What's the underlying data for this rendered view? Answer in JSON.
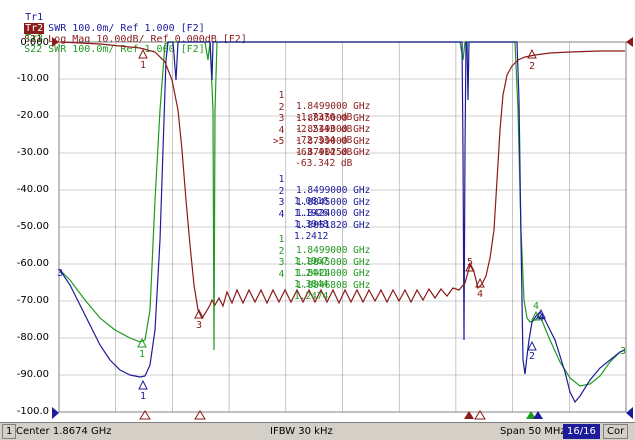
{
  "colors": {
    "s11": "#1c1c9a",
    "s21": "#8b1a1a",
    "s22": "#1f9a1f",
    "grid": "#a0a0a0",
    "plot_bg": "#ffffff",
    "status_bg": "#d4d0c8"
  },
  "traces": [
    {
      "id": "Tr1",
      "label": "S11 SWR 100.0m/ Ref 1.000 [F2]",
      "active": false
    },
    {
      "id": "Tr2",
      "label": "S21 Log Mag 10.00dB/ Ref 0.000dB [F2]",
      "active": true
    },
    {
      "id": "Tr3",
      "label": "S22 SWR 100.0m/ Ref 1.000 [F2]",
      "active": false
    }
  ],
  "y_axis": {
    "labels": [
      "0.000",
      "-10.00",
      "-20.00",
      "-30.00",
      "-40.00",
      "-50.00",
      "-60.00",
      "-70.00",
      "-80.00",
      "-90.00",
      "-100.0"
    ]
  },
  "marker_tables": {
    "s21": [
      {
        "num": "1",
        "freq": "1.8499000 GHz",
        "value": "-1.7376 dB"
      },
      {
        "num": "2",
        "freq": "1.8845000 GHz",
        "value": "-2.2143 dB"
      },
      {
        "num": "3",
        "freq": "1.8549000 GHz",
        "value": "-72.334 dB"
      },
      {
        "num": "4",
        "freq": "1.8799000 GHz",
        "value": "-63.414 dB"
      },
      {
        "num": ">5",
        "freq": "1.8790250 GHz",
        "value": "-63.342 dB"
      }
    ],
    "s11": [
      {
        "num": "1",
        "freq": "1.8499000 GHz",
        "value": "1.0816"
      },
      {
        "num": "2",
        "freq": "1.8845000 GHz",
        "value": "1.1926"
      },
      {
        "num": "3",
        "freq": "1.8424000 GHz",
        "value": "1.3948"
      },
      {
        "num": "4",
        "freq": "1.8851820 GHz",
        "value": "1.2412"
      }
    ],
    "s22": [
      {
        "num": "1",
        "freq": "1.8499000 GHz",
        "value": "1.1967"
      },
      {
        "num": "2",
        "freq": "1.8845000 GHz",
        "value": "1.2441"
      },
      {
        "num": "3",
        "freq": "1.8424000 GHz",
        "value": "1.3844"
      },
      {
        "num": "4",
        "freq": "1.8846808 GHz",
        "value": "1.2474"
      }
    ]
  },
  "status": {
    "channel": "1",
    "center": "Center 1.8674 GHz",
    "ifbw": "IFBW 30 kHz",
    "span": "Span 50 MHz",
    "points": "16/16",
    "cor": "Cor"
  }
}
